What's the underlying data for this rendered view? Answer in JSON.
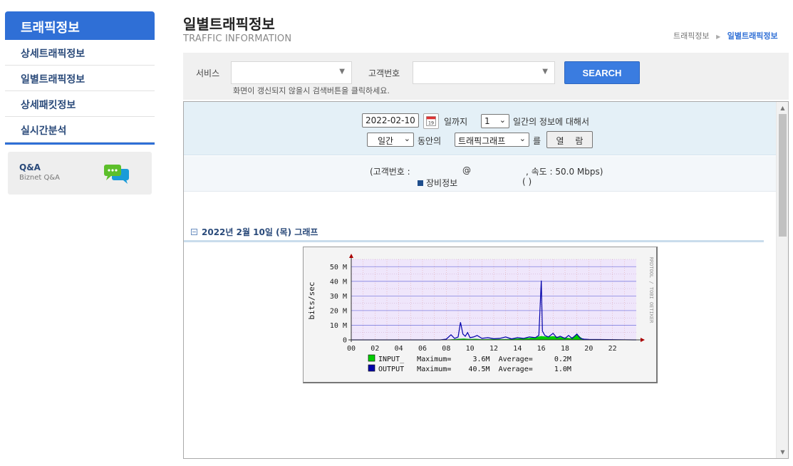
{
  "sidebar": {
    "title": "트래픽정보",
    "items": [
      {
        "label": "상세트래픽정보"
      },
      {
        "label": "일별트래픽정보"
      },
      {
        "label": "상세패킷정보"
      },
      {
        "label": "실시간분석"
      }
    ],
    "qa": {
      "title": "Q&A",
      "subtitle": "Biznet Q&A",
      "icon": "chat-bubbles-icon"
    }
  },
  "header": {
    "title": "일별트래픽정보",
    "subtitle": "TRAFFIC INFORMATION",
    "breadcrumb": [
      "트래픽정보",
      "일별트래픽정보"
    ]
  },
  "search": {
    "service_label": "서비스",
    "service_value": "",
    "customer_label": "고객번호",
    "customer_value": "",
    "button": "SEARCH",
    "hint": "화면이 갱신되지 않을시 검색버튼을 클릭하세요."
  },
  "controls": {
    "date": "2022-02-10",
    "until_label": "일까지",
    "days_value": "1",
    "period_text": "일간의 정보에 대해서",
    "unit_value": "일간",
    "during_label": "동안의",
    "type_value": "트래픽그래프",
    "reul_label": "를",
    "view_button": "열 람"
  },
  "info": {
    "customer_prefix": "(고객번호 :",
    "at": "@",
    "speed": ", 속도 : 50.0 Mbps)",
    "equip_label": "장비정보",
    "equip_paren": "(        )"
  },
  "graph": {
    "heading": "2022년 2월 10일 (목) 그래프",
    "side_text": "RRDTOOL / TOBI OETIKER"
  },
  "chart_data": {
    "type": "area",
    "title": "",
    "ylabel": "bits/sec",
    "xlabel": "",
    "x_ticks": [
      "00",
      "02",
      "04",
      "06",
      "08",
      "10",
      "12",
      "14",
      "16",
      "18",
      "20",
      "22"
    ],
    "y_ticks": [
      "0",
      "10 M",
      "20 M",
      "30 M",
      "40 M",
      "50 M"
    ],
    "ylim": [
      0,
      55
    ],
    "grid": true,
    "series": [
      {
        "name": "INPUT_",
        "color": "#00cc00",
        "legend_text": "INPUT_   Maximum=     3.6M  Average=     0.2M",
        "x": [
          0,
          8,
          8.5,
          9,
          9.5,
          10,
          10.5,
          11,
          12,
          13,
          14,
          15,
          15.5,
          16,
          16.5,
          17,
          17.5,
          18,
          18.5,
          19,
          19.5,
          20,
          24
        ],
        "values": [
          0,
          0,
          0.3,
          0.6,
          0.8,
          0.5,
          0.6,
          0.3,
          0.5,
          0.4,
          0.8,
          1.2,
          1.6,
          2.5,
          2.0,
          2.4,
          1.8,
          1.4,
          1.0,
          3.6,
          0.5,
          0,
          0
        ]
      },
      {
        "name": "OUTPUT",
        "color": "#0000aa",
        "legend_text": "OUTPUT   Maximum=    40.5M  Average=     1.0M",
        "x": [
          0,
          7.5,
          8,
          8.4,
          8.7,
          9,
          9.2,
          9.4,
          9.6,
          9.8,
          10,
          10.3,
          10.6,
          11,
          11.5,
          12,
          12.5,
          13,
          13.5,
          14,
          14.5,
          15,
          15.5,
          15.8,
          16,
          16.1,
          16.3,
          16.6,
          17,
          17.3,
          17.6,
          18,
          18.3,
          18.6,
          19,
          19.3,
          19.6,
          20,
          24
        ],
        "values": [
          0,
          0,
          0.5,
          3.5,
          1.0,
          2.0,
          12.0,
          4.0,
          2.5,
          5.0,
          1.5,
          2.0,
          3.0,
          1.0,
          1.5,
          0.8,
          1.0,
          2.0,
          0.7,
          1.5,
          1.0,
          2.0,
          1.5,
          3.0,
          40.5,
          6.0,
          3.0,
          2.0,
          4.5,
          1.5,
          2.5,
          1.0,
          3.0,
          1.0,
          4.0,
          1.0,
          0.5,
          0.3,
          0
        ]
      }
    ]
  }
}
